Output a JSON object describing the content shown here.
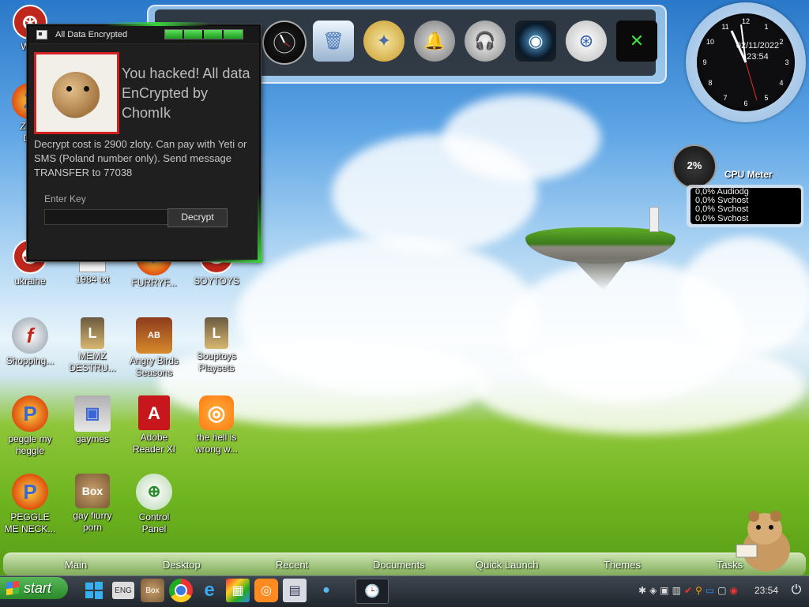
{
  "desktop_icons": [
    {
      "id": "winver",
      "label": "WIN\nV",
      "glyph": "⊛",
      "style": "i-red"
    },
    {
      "id": "zoo",
      "label": "ZOO\nDE",
      "glyph": "Z",
      "style": "i-peggle"
    },
    {
      "id": "ukraine",
      "label": "ukraine",
      "glyph": "☢",
      "style": "i-red"
    },
    {
      "id": "1984",
      "label": "1984 txt",
      "glyph": "≡",
      "style": "i-doc"
    },
    {
      "id": "furry",
      "label": "FURRYF...",
      "glyph": "◐",
      "style": "i-peggle"
    },
    {
      "id": "soytoys",
      "label": "SOYTOYS",
      "glyph": "S",
      "style": "i-red"
    },
    {
      "id": "shopping",
      "label": "Shopping...",
      "glyph": "f",
      "style": "i-flash"
    },
    {
      "id": "memz",
      "label": "MEMZ\nDESTRU...",
      "glyph": "L",
      "style": "i-memz"
    },
    {
      "id": "angry",
      "label": "Angry Birds\nSeasons",
      "glyph": "AB",
      "style": "i-angry"
    },
    {
      "id": "souptoys",
      "label": "Souptoys\nPlaysets",
      "glyph": "L",
      "style": "i-memz"
    },
    {
      "id": "peggle1",
      "label": "peggle my\nheggle",
      "glyph": "P",
      "style": "i-peggle"
    },
    {
      "id": "gaymes",
      "label": "gaymes",
      "glyph": "▣",
      "style": "i-gay"
    },
    {
      "id": "adobe",
      "label": "Adobe\nReader XI",
      "glyph": "A",
      "style": "i-adobe"
    },
    {
      "id": "uc",
      "label": "the hell is\nwrong w...",
      "glyph": "◎",
      "style": "i-uc"
    },
    {
      "id": "peggle2",
      "label": "PEGGLE\nME NECK...",
      "glyph": "P",
      "style": "i-peggle"
    },
    {
      "id": "gayporn",
      "label": "gay fiurry\nporn",
      "glyph": "Box",
      "style": "i-box"
    },
    {
      "id": "control",
      "label": "Control\nPanel",
      "glyph": "⊕",
      "style": "i-cp"
    }
  ],
  "dock_items": [
    "clock-icon",
    "recycle-bin-icon",
    "globe-icon",
    "bell-icon",
    "headphones-icon",
    "camera-icon",
    "compass-icon",
    "razer-icon"
  ],
  "malware_window": {
    "title": "All Data Encrypted",
    "headline": "You hacked! All data EnCrypted by ChomIk",
    "message": "Decrypt cost is 2900 zloty. Can pay with Yeti or SMS (Poland number only). Send message TRANSFER to 77038",
    "key_label": "Enter Key",
    "key_value": "",
    "decrypt_label": "Decrypt",
    "progress": 1.0
  },
  "clock": {
    "date": "02/11/2022",
    "time": "23:54",
    "numbers": [
      "12",
      "1",
      "2",
      "3",
      "4",
      "5",
      "6",
      "7",
      "8",
      "9",
      "10",
      "11"
    ]
  },
  "cpu_meter": {
    "percent": "2%",
    "title": "CPU Meter",
    "processes": [
      "0,0% Audiodg",
      "0,0% Svchost",
      "0,0% Svchost",
      "0,0% Svchost"
    ]
  },
  "launch_bar": {
    "tabs": [
      "Main",
      "Desktop",
      "Recent",
      "Documents",
      "Quick Launch",
      "Themes",
      "Tasks"
    ]
  },
  "taskbar": {
    "start_label": "start",
    "lang": "ENG",
    "time": "23:54"
  },
  "colors": {
    "accent_green": "#3cd03c",
    "alert_red": "#d02020"
  }
}
